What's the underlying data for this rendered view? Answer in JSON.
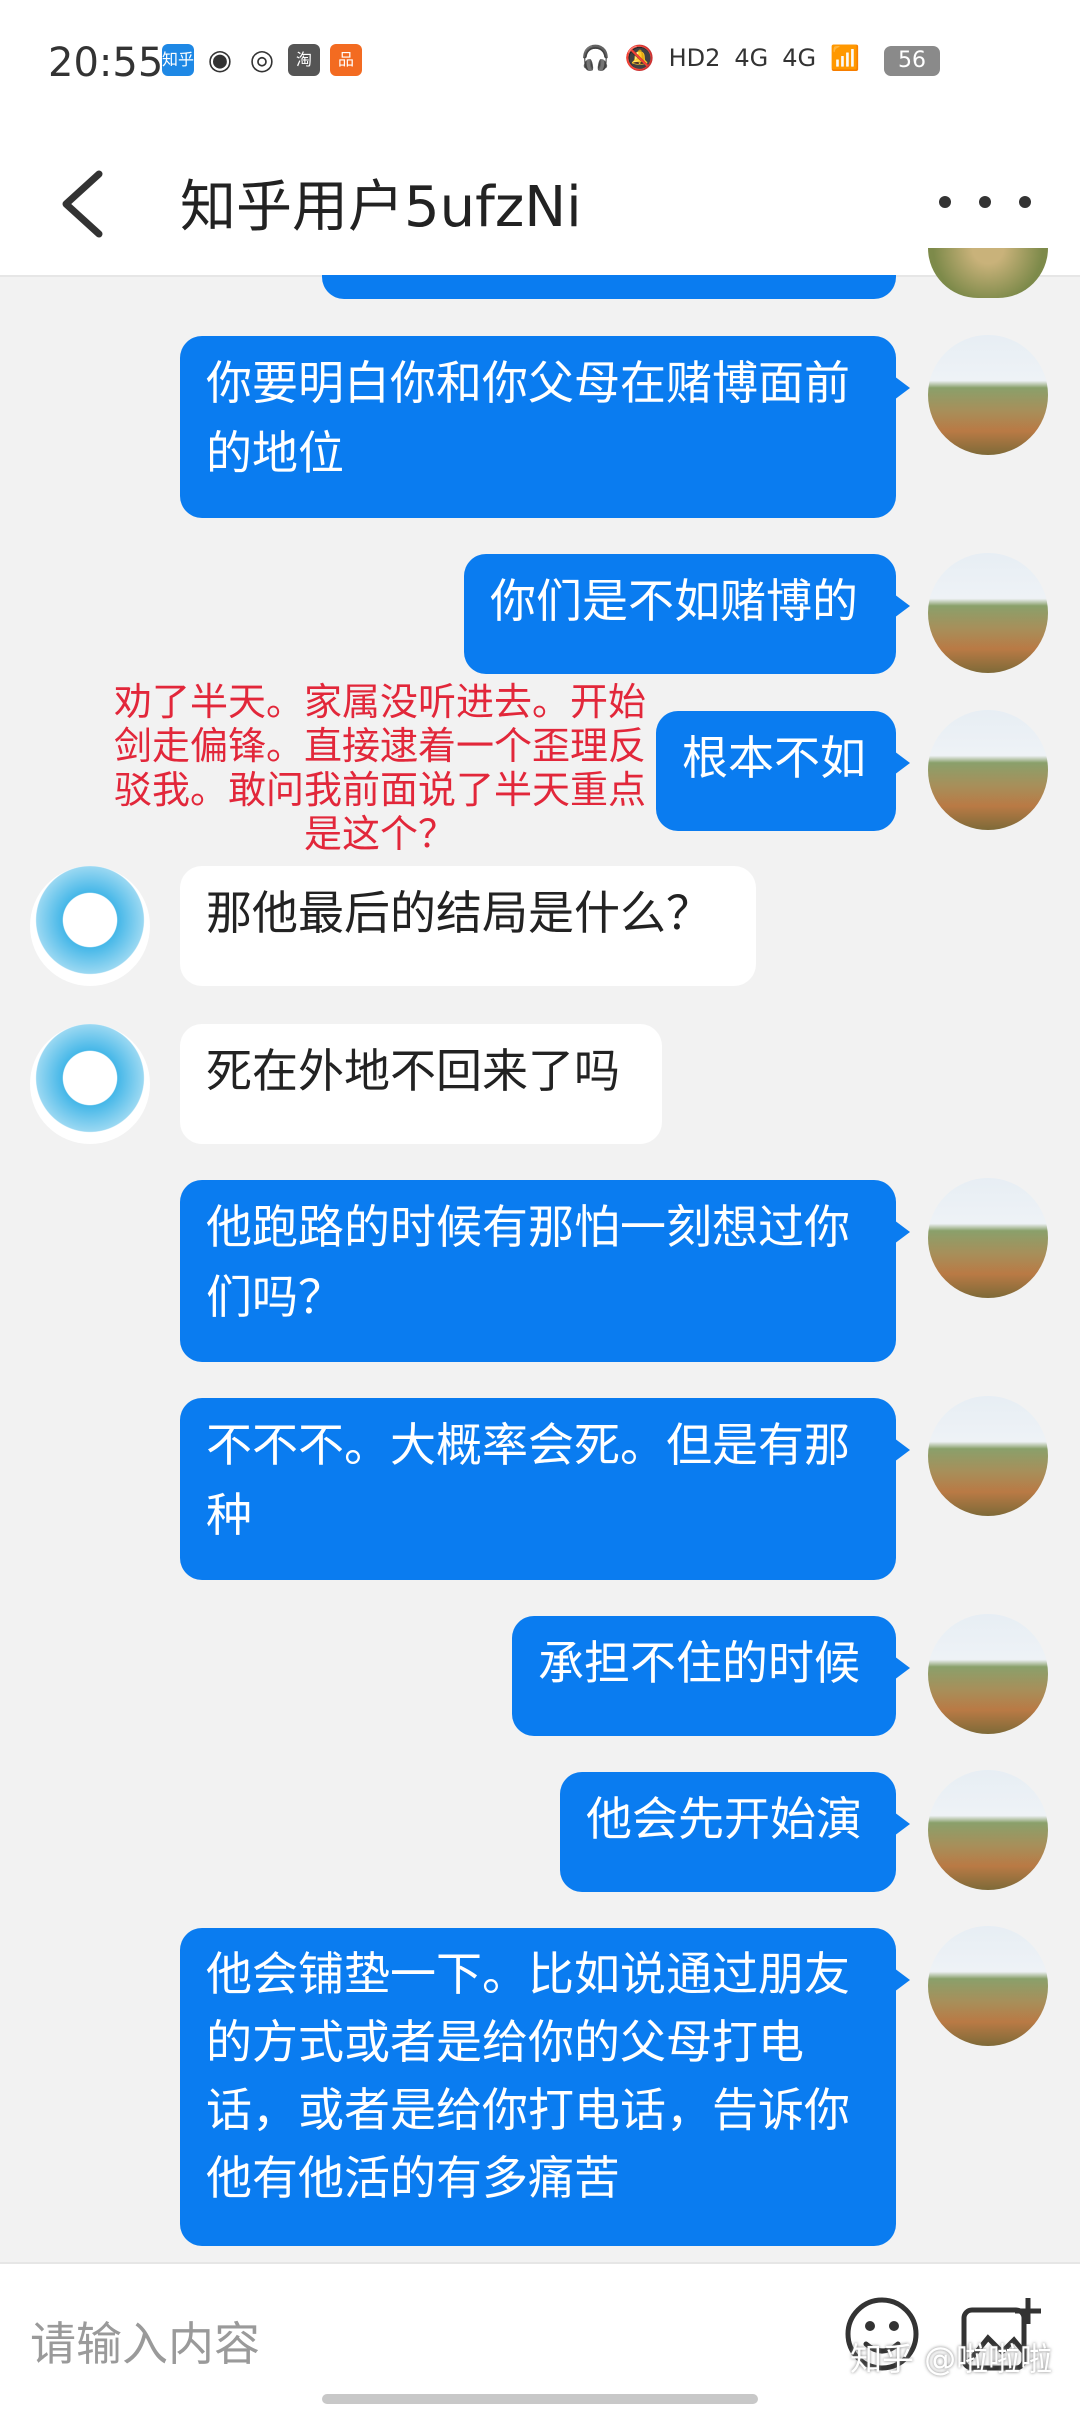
{
  "status_bar": {
    "time": "20:55",
    "app_icons": [
      "知乎",
      "微博",
      "网易",
      "淘",
      "品"
    ],
    "indicators": [
      "headphones-icon",
      "mute-icon",
      "HD2",
      "4G",
      "4G",
      "wifi-icon"
    ],
    "battery": "56"
  },
  "header": {
    "title": "知乎用户5ufzNi"
  },
  "messages": [
    {
      "side": "me",
      "text": "你要明白你和你父母在赌博面前的地位"
    },
    {
      "side": "me",
      "text": "你们是不如赌博的"
    },
    {
      "side": "me",
      "text": "根本不如"
    },
    {
      "side": "other",
      "text": "那他最后的结局是什么？"
    },
    {
      "side": "other",
      "text": "死在外地不回来了吗"
    },
    {
      "side": "me",
      "text": "他跑路的时候有那怕一刻想过你们吗？"
    },
    {
      "side": "me",
      "text": "不不不。大概率会死。但是有那种"
    },
    {
      "side": "me",
      "text": "承担不住的时候"
    },
    {
      "side": "me",
      "text": "他会先开始演"
    },
    {
      "side": "me",
      "text": "他会铺垫一下。比如说通过朋友的方式或者是给你的父母打电话，或者是给你打电话，告诉你他有他活的有多痛苦"
    }
  ],
  "annotation": "劝了半天。家属没听进去。开始剑走偏锋。直接逮着一个歪理反驳我。敢问我前面说了半天重点是这个？",
  "input": {
    "placeholder": "请输入内容"
  },
  "watermark": "知乎 @啦啦啦",
  "colors": {
    "my_bubble": "#0a7cf0",
    "other_bubble": "#ffffff",
    "annotation": "#e2273a"
  }
}
